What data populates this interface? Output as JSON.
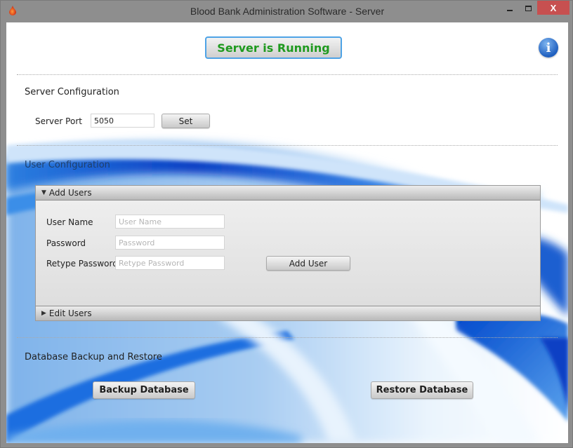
{
  "window": {
    "title": "Blood Bank Administration Software - Server",
    "controls": {
      "minimize": "minimize",
      "maximize": "maximize",
      "close": "X"
    }
  },
  "status": {
    "label": "Server is Running",
    "color": "#1f9a1f",
    "info_icon": "i"
  },
  "server_config": {
    "title": "Server Configuration",
    "port_label": "Server Port",
    "port_value": "5050",
    "set_button": "Set"
  },
  "user_config": {
    "title": "User Configuration",
    "add_users_panel": {
      "header": "Add Users",
      "expanded_icon": "▼",
      "fields": [
        {
          "label": "User Name",
          "value": "",
          "placeholder": "User Name"
        },
        {
          "label": "Password",
          "value": "",
          "placeholder": "Password"
        },
        {
          "label": "Retype Password",
          "value": "",
          "placeholder": "Retype Password"
        }
      ],
      "add_button": "Add User"
    },
    "edit_users_panel": {
      "header": "Edit Users",
      "collapsed_icon": "▶"
    }
  },
  "database": {
    "title": "Database Backup and Restore",
    "backup_button": "Backup Database",
    "restore_button": "Restore Database"
  },
  "colors": {
    "accent_blue": "#1f5fbf",
    "close_red": "#c75050",
    "focus_border": "#4ea3e6"
  }
}
